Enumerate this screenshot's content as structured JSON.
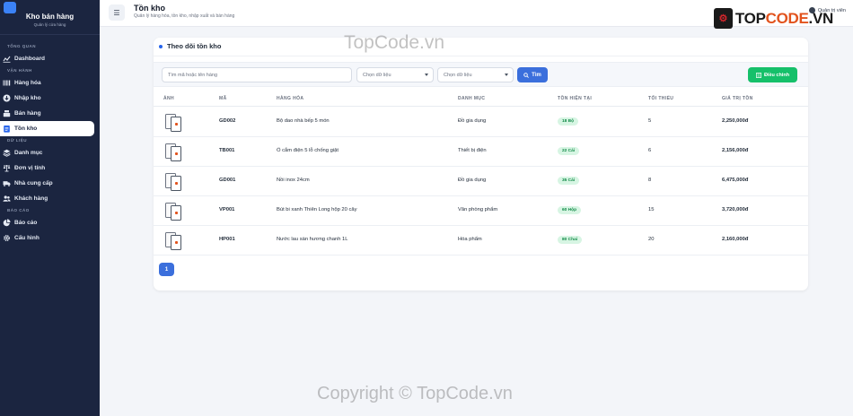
{
  "app": {
    "name": "Kho bán hàng",
    "subtitle": "Quản lý cửa hàng"
  },
  "sidebar": {
    "sections": [
      {
        "title": "TỔNG QUAN",
        "items": [
          {
            "label": "Dashboard",
            "icon": "chart-line-icon",
            "active": false
          }
        ]
      },
      {
        "title": "VẬN HÀNH",
        "items": [
          {
            "label": "Hàng hóa",
            "icon": "barcode-icon",
            "active": false
          },
          {
            "label": "Nhập kho",
            "icon": "download-icon",
            "active": false
          },
          {
            "label": "Bán hàng",
            "icon": "cash-register-icon",
            "active": false
          },
          {
            "label": "Tồn kho",
            "icon": "clipboard-list-icon",
            "active": true
          }
        ]
      },
      {
        "title": "DỮ LIỆU",
        "items": [
          {
            "label": "Danh mục",
            "icon": "layers-icon",
            "active": false
          },
          {
            "label": "Đơn vị tính",
            "icon": "scale-icon",
            "active": false
          },
          {
            "label": "Nhà cung cấp",
            "icon": "truck-icon",
            "active": false
          },
          {
            "label": "Khách hàng",
            "icon": "users-icon",
            "active": false
          }
        ]
      },
      {
        "title": "BÁO CÁO",
        "items": [
          {
            "label": "Báo cáo",
            "icon": "pie-chart-icon",
            "active": false
          },
          {
            "label": "Cấu hình",
            "icon": "gear-icon",
            "active": false
          }
        ]
      }
    ]
  },
  "header": {
    "title": "Tồn kho",
    "subtitle": "Quản lý hàng hóa, tồn kho, nhập xuất và bán hàng",
    "user": "Quản trị viên",
    "brand_logo": {
      "text_a": "TOP",
      "text_b": "CODE",
      "text_c": ".VN"
    }
  },
  "card": {
    "title": "Theo dõi tồn kho",
    "search_placeholder": "Tìm mã hoặc tên hàng",
    "select1": "Chọn dữ liệu",
    "select2": "Chọn dữ liệu",
    "search_button": "Tìm",
    "adjust_button": "Điều chỉnh"
  },
  "table": {
    "headers": [
      "ẢNH",
      "MÃ",
      "HÀNG HÓA",
      "DANH MỤC",
      "TỒN HIỆN TẠI",
      "TỐI THIỂU",
      "GIÁ TRỊ TỒN"
    ],
    "rows": [
      {
        "code": "GD002",
        "name": "Bộ dao nhà bếp 5 món",
        "category": "Đồ gia dụng",
        "stock": "18 Bộ",
        "min": "5",
        "value": "2,250,000đ"
      },
      {
        "code": "TB001",
        "name": "Ổ cắm điện 5 lỗ chống giật",
        "category": "Thiết bị điện",
        "stock": "22 Cái",
        "min": "6",
        "value": "2,156,000đ"
      },
      {
        "code": "GD001",
        "name": "Nồi inox 24cm",
        "category": "Đồ gia dụng",
        "stock": "35 Cái",
        "min": "8",
        "value": "6,475,000đ"
      },
      {
        "code": "VP001",
        "name": "Bút bi xanh Thiên Long hộp 20 cây",
        "category": "Văn phòng phẩm",
        "stock": "60 Hộp",
        "min": "15",
        "value": "3,720,000đ"
      },
      {
        "code": "HP001",
        "name": "Nước lau sàn hương chanh 1L",
        "category": "Hóa phẩm",
        "stock": "80 Chai",
        "min": "20",
        "value": "2,160,000đ"
      }
    ]
  },
  "pagination": {
    "current": "1"
  },
  "watermarks": {
    "top": "TopCode.vn",
    "bottom": "Copyright © TopCode.vn"
  }
}
